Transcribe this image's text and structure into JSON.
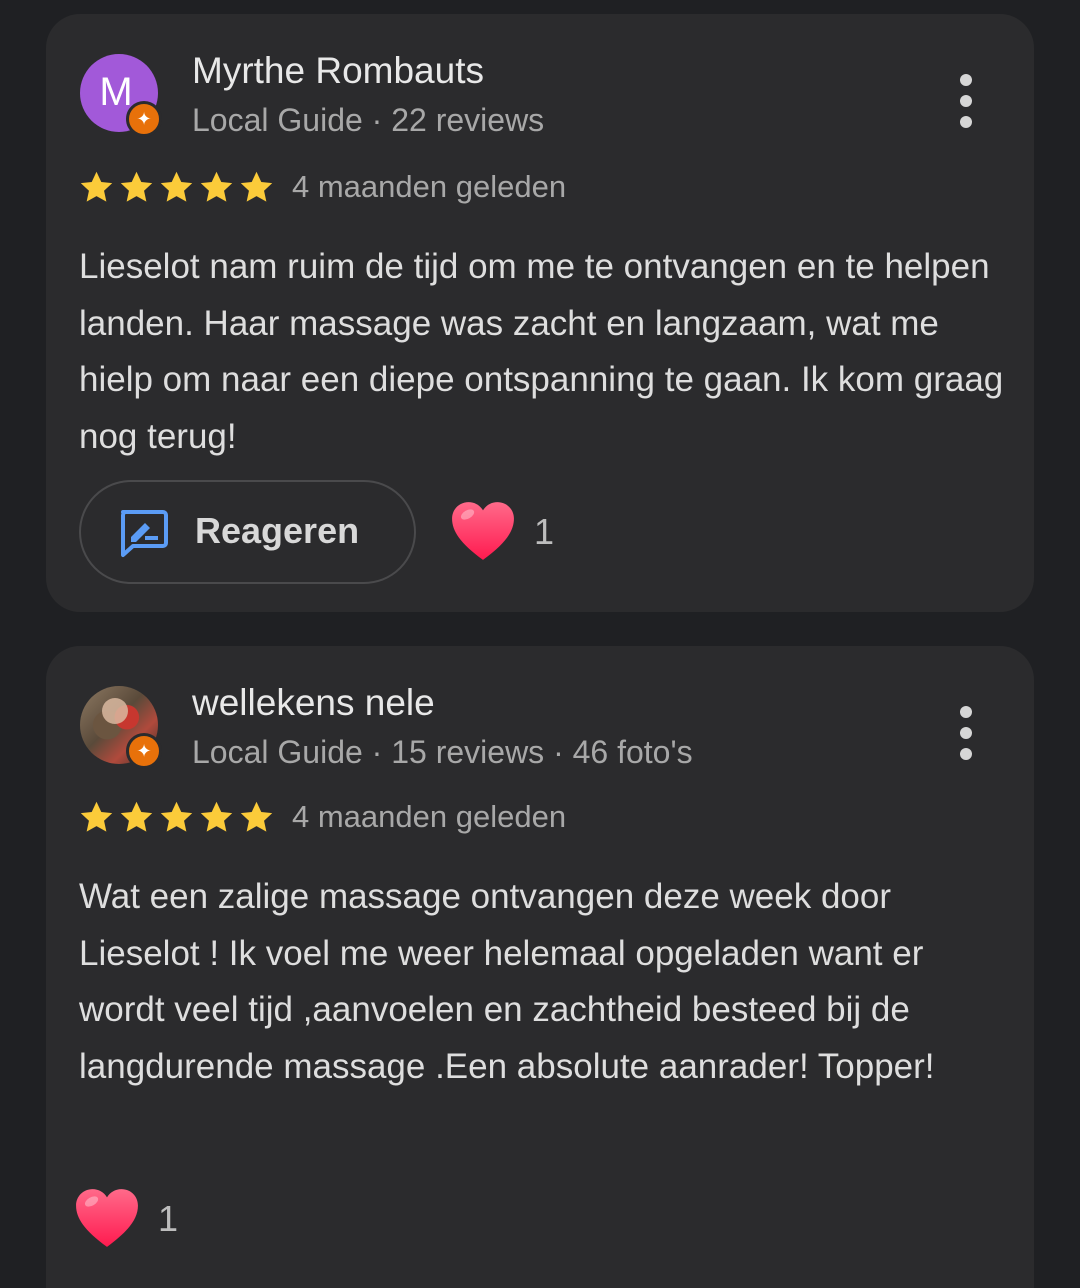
{
  "reviews": [
    {
      "author": "Myrthe Rombauts",
      "avatar_letter": "M",
      "meta": "Local Guide · 22 reviews",
      "rating": 5,
      "time": "4 maanden geleden",
      "text": "Lieselot nam ruim de tijd om me te ontvangen en te helpen landen. Haar massage was zacht en langzaam, wat me hielp om naar een diepe ontspanning te gaan. Ik kom graag nog terug!",
      "reply_label": "Reageren",
      "likes": "1"
    },
    {
      "author": "wellekens nele",
      "meta": "Local Guide · 15 reviews · 46 foto's",
      "rating": 5,
      "time": "4 maanden geleden",
      "text": "Wat een zalige massage ontvangen deze week door Lieselot ! Ik voel me weer helemaal opgeladen want er wordt veel tijd ,aanvoelen en zachtheid besteed bij de langdurende massage .Een absolute aanrader! Topper!",
      "likes": "1"
    }
  ],
  "icons": {
    "star": "star-icon",
    "heart": "heart-icon",
    "reply": "reply-icon",
    "more": "more-vert-icon",
    "guide_badge": "local-guide-badge-icon"
  },
  "colors": {
    "background": "#1f2023",
    "card": "#2b2b2d",
    "star": "#fbcb3a",
    "heart": "#ff2d5f",
    "reply_icon": "#5b9cf5",
    "avatar_m": "#a259d9",
    "guide_badge": "#e8710a"
  }
}
